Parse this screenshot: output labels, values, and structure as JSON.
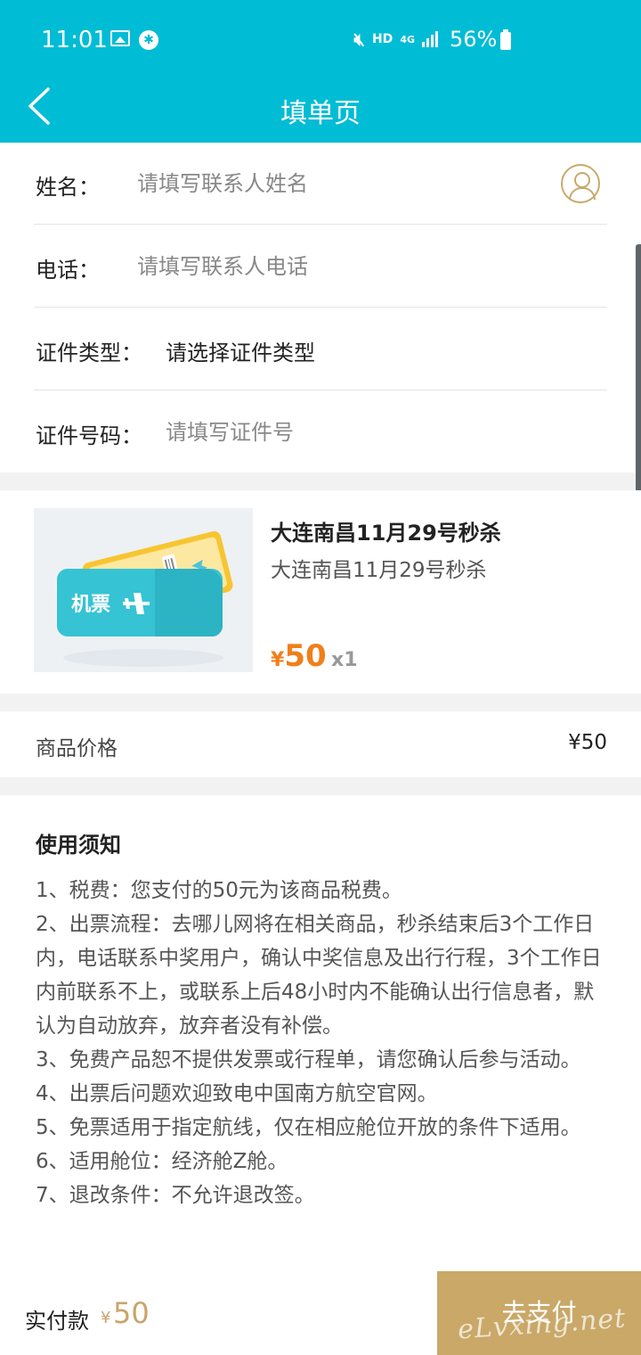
{
  "status_bar": {
    "time": "11:01",
    "battery": "56%",
    "network": "4G",
    "hd": "HD",
    "icons": [
      "image-icon",
      "chat-icon",
      "mute-icon",
      "signal-icon",
      "battery-icon"
    ]
  },
  "header": {
    "title": "填单页",
    "back_icon": "back-chevron-icon"
  },
  "form": {
    "name": {
      "label": "姓名：",
      "placeholder": "请填写联系人姓名",
      "value": "",
      "icon": "contact-person-icon"
    },
    "phone": {
      "label": "电话：",
      "placeholder": "请填写联系人电话",
      "value": ""
    },
    "id_type": {
      "label": "证件类型：",
      "value": "请选择证件类型"
    },
    "id_number": {
      "label": "证件号码：",
      "placeholder": "请填写证件号",
      "value": ""
    }
  },
  "product": {
    "image_label": "机票",
    "image_icon": "airplane-icon",
    "title": "大连南昌11月29号秒杀",
    "subtitle": "大连南昌11月29号秒杀",
    "currency": "¥",
    "price": "50",
    "quantity": "x1"
  },
  "price_row": {
    "label": "商品价格",
    "value": "¥50"
  },
  "notice": {
    "title": "使用须知",
    "items": [
      "1、税费：您支付的50元为该商品税费。",
      "2、出票流程：去哪儿网将在相关商品，秒杀结束后3个工作日内，电话联系中奖用户，确认中奖信息及出行行程，3个工作日内前联系不上，或联系上后48小时内不能确认出行信息者，默认为自动放弃，放弃者没有补偿。",
      "3、免费产品恕不提供发票或行程单，请您确认后参与活动。",
      "4、出票后问题欢迎致电中国南方航空官网。",
      "5、免票适用于指定航线，仅在相应舱位开放的条件下适用。",
      "6、适用舱位：经济舱Z舱。",
      "7、退改条件：不允许退改签。"
    ]
  },
  "bottom_bar": {
    "total_label": "实付款",
    "currency": "¥",
    "total": "50",
    "pay_button": "去支付",
    "watermark": "eLvxing.net"
  },
  "colors": {
    "primary": "#00bcd4",
    "accent_gold": "#c9a868",
    "price_orange": "#f07f1a"
  }
}
